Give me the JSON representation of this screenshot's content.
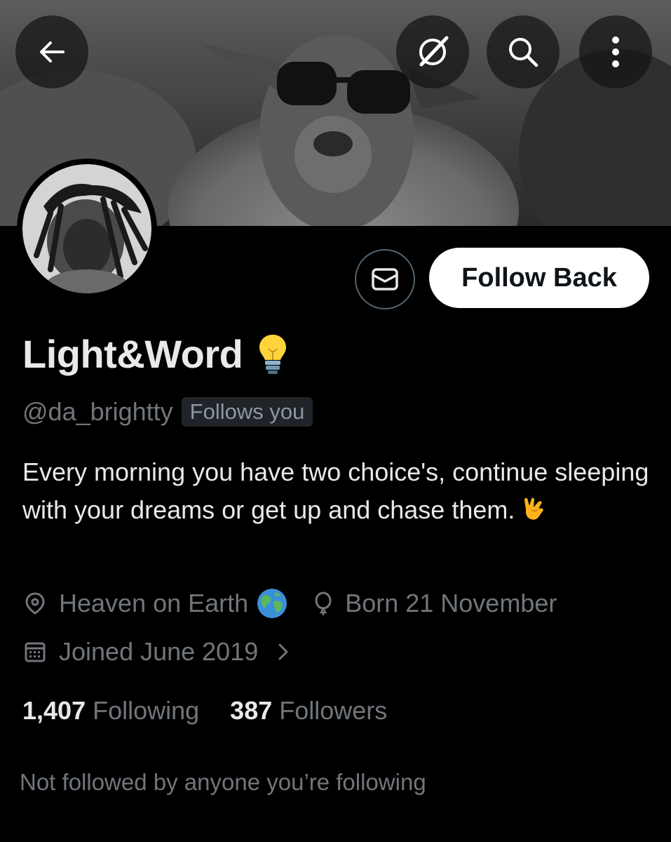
{
  "header": {
    "back_icon": "arrow-left-icon",
    "grok_icon": "grok-icon",
    "search_icon": "search-icon",
    "more_icon": "more-vertical-icon"
  },
  "profile": {
    "display_name": "Light&Word",
    "name_emoji": "light-bulb-icon",
    "handle": "@da_brightty",
    "follows_you_badge": "Follows you",
    "bio": "Every morning you have two choice's, continue sleeping with your dreams or get up and chase them.",
    "bio_emoji": "love-you-gesture-icon",
    "location": "Heaven on Earth",
    "location_emoji": "globe-icon",
    "birthday": "Born 21 November",
    "joined": "Joined June 2019",
    "following_count": "1,407",
    "following_label": "Following",
    "followers_count": "387",
    "followers_label": "Followers",
    "not_followed_text": "Not followed by anyone you’re following"
  },
  "actions": {
    "follow_back_label": "Follow Back",
    "message_icon": "envelope-icon"
  },
  "colors": {
    "background": "#000000",
    "primary_text": "#e7e9ea",
    "secondary_text": "#71767b",
    "button_bg": "#ffffff",
    "button_text": "#0f1419"
  }
}
